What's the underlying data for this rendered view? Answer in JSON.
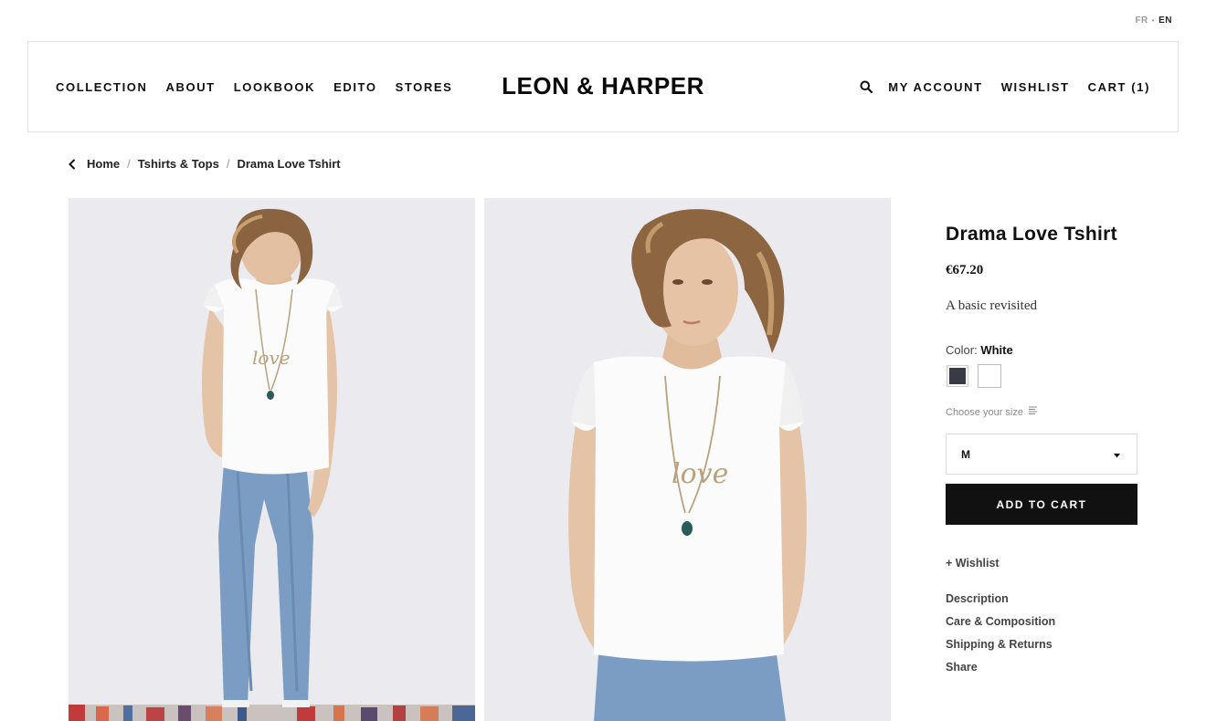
{
  "language": {
    "fr": "FR",
    "separator": "•",
    "en": "EN"
  },
  "header": {
    "nav_left": [
      "COLLECTION",
      "ABOUT",
      "LOOKBOOK",
      "EDITO",
      "STORES"
    ],
    "logo": "LEON & HARPER",
    "nav_right": {
      "account": "MY ACCOUNT",
      "wishlist": "WISHLIST",
      "cart": "CART (1)"
    },
    "search_icon": "search-icon"
  },
  "breadcrumb": {
    "back_icon": "chevron-left-icon",
    "items": [
      "Home",
      "Tshirts & Tops",
      "Drama Love Tshirt"
    ],
    "separator": "/"
  },
  "product": {
    "title": "Drama Love Tshirt",
    "price": "€67.20",
    "tagline": "A basic revisited",
    "color_label": "Color:",
    "color_value": "White",
    "swatches": [
      {
        "name": "dark",
        "color": "#3a3a47"
      },
      {
        "name": "white",
        "color": "#ffffff"
      }
    ],
    "size_guide": "Choose your size",
    "size_selected": "M",
    "add_to_cart": "ADD TO CART",
    "wishlist": "+ Wishlist",
    "sections": [
      "Description",
      "Care & Composition",
      "Shipping & Returns",
      "Share"
    ]
  },
  "colors": {
    "accent": "#111111",
    "photo_bg": "#ebeaee",
    "border": "#e2e2e2"
  }
}
